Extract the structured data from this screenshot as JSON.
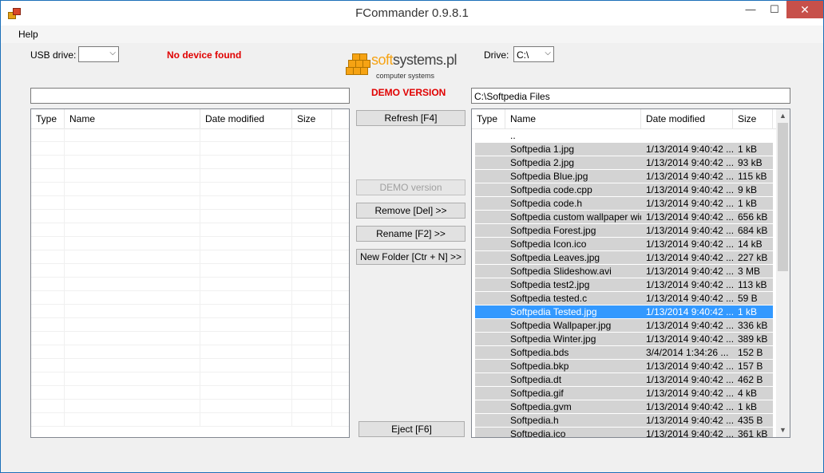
{
  "window": {
    "title": "FCommander 0.9.8.1",
    "min": "—",
    "max": "☐",
    "close": "✕"
  },
  "menu": {
    "help": "Help"
  },
  "usb": {
    "label": "USB drive:",
    "value": "",
    "status": "No device found",
    "path": ""
  },
  "logo": {
    "brand_soft": "soft",
    "brand_rest": "systems.pl",
    "sub": "computer systems"
  },
  "demo_label": "DEMO VERSION",
  "drive": {
    "label": "Drive:",
    "value": "C:\\",
    "path": "C:\\Softpedia Files"
  },
  "columns": [
    "Type",
    "Name",
    "Date modified",
    "Size"
  ],
  "buttons": {
    "refresh": "Refresh [F4]",
    "demo": "DEMO version",
    "remove": "Remove [Del] >>",
    "rename": "Rename [F2] >>",
    "new_folder": "New Folder [Ctr + N] >>",
    "eject": "Eject [F6]"
  },
  "files": [
    {
      "type": "",
      "name": "..",
      "date": "",
      "size": ""
    },
    {
      "type": "",
      "name": "Softpedia 1.jpg",
      "date": "1/13/2014 9:40:42 ...",
      "size": "1 kB"
    },
    {
      "type": "",
      "name": "Softpedia 2.jpg",
      "date": "1/13/2014 9:40:42 ...",
      "size": "93 kB"
    },
    {
      "type": "",
      "name": "Softpedia Blue.jpg",
      "date": "1/13/2014 9:40:42 ...",
      "size": "115 kB"
    },
    {
      "type": "",
      "name": "Softpedia code.cpp",
      "date": "1/13/2014 9:40:42 ...",
      "size": "9 kB"
    },
    {
      "type": "",
      "name": "Softpedia code.h",
      "date": "1/13/2014 9:40:42 ...",
      "size": "1 kB"
    },
    {
      "type": "",
      "name": "Softpedia custom wallpaper wid...",
      "date": "1/13/2014 9:40:42 ...",
      "size": "656 kB"
    },
    {
      "type": "",
      "name": "Softpedia Forest.jpg",
      "date": "1/13/2014 9:40:42 ...",
      "size": "684 kB"
    },
    {
      "type": "",
      "name": "Softpedia Icon.ico",
      "date": "1/13/2014 9:40:42 ...",
      "size": "14 kB"
    },
    {
      "type": "",
      "name": "Softpedia Leaves.jpg",
      "date": "1/13/2014 9:40:42 ...",
      "size": "227 kB"
    },
    {
      "type": "",
      "name": "Softpedia Slideshow.avi",
      "date": "1/13/2014 9:40:42 ...",
      "size": "3 MB"
    },
    {
      "type": "",
      "name": "Softpedia test2.jpg",
      "date": "1/13/2014 9:40:42 ...",
      "size": "113 kB"
    },
    {
      "type": "",
      "name": "Softpedia tested.c",
      "date": "1/13/2014 9:40:42 ...",
      "size": "59 B"
    },
    {
      "type": "",
      "name": "Softpedia Tested.jpg",
      "date": "1/13/2014 9:40:42 ...",
      "size": "1 kB",
      "selected": true
    },
    {
      "type": "",
      "name": "Softpedia Wallpaper.jpg",
      "date": "1/13/2014 9:40:42 ...",
      "size": "336 kB"
    },
    {
      "type": "",
      "name": "Softpedia Winter.jpg",
      "date": "1/13/2014 9:40:42 ...",
      "size": "389 kB"
    },
    {
      "type": "",
      "name": "Softpedia.bds",
      "date": "3/4/2014 1:34:26 ...",
      "size": "152 B"
    },
    {
      "type": "",
      "name": "Softpedia.bkp",
      "date": "1/13/2014 9:40:42 ...",
      "size": "157 B"
    },
    {
      "type": "",
      "name": "Softpedia.dt",
      "date": "1/13/2014 9:40:42 ...",
      "size": "462 B"
    },
    {
      "type": "",
      "name": "Softpedia.gif",
      "date": "1/13/2014 9:40:42 ...",
      "size": "4 kB"
    },
    {
      "type": "",
      "name": "Softpedia.gvm",
      "date": "1/13/2014 9:40:42 ...",
      "size": "1 kB"
    },
    {
      "type": "",
      "name": "Softpedia.h",
      "date": "1/13/2014 9:40:42 ...",
      "size": "435 B"
    },
    {
      "type": "",
      "name": "Softpedia.ico",
      "date": "1/13/2014 9:40:42 ...",
      "size": "361 kB"
    }
  ],
  "colors": {
    "accent": "#1b6fb8",
    "warning": "#e00000",
    "selection": "#3399ff",
    "logo": "#f6a313"
  }
}
